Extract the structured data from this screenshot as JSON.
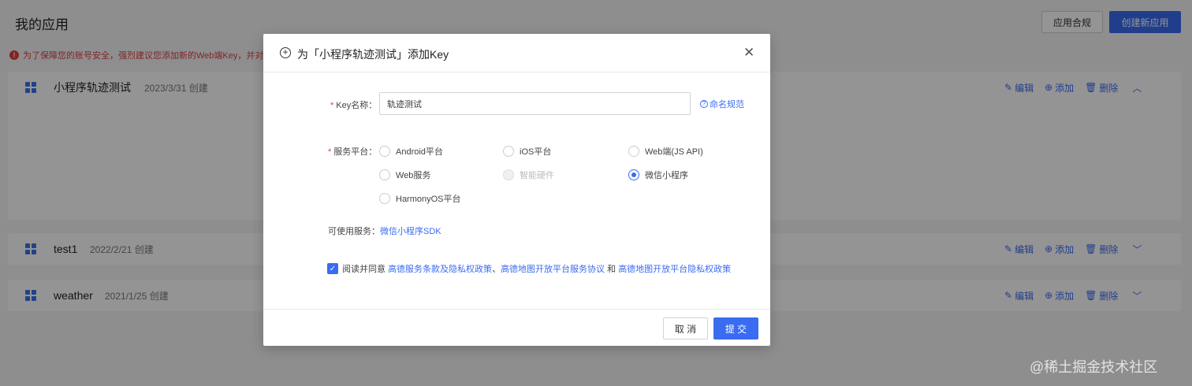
{
  "page": {
    "title": "我的应用",
    "compliance_button": "应用合规",
    "create_button": "创建新应用",
    "warning": "为了保障您的账号安全，强烈建议您添加新的Web端Key，并对原"
  },
  "apps": [
    {
      "name": "小程序轨迹测试",
      "date": "2023/3/31 创建",
      "edit": "编辑",
      "add": "添加",
      "delete": "删除"
    },
    {
      "name": "test1",
      "date": "2022/2/21 创建",
      "edit": "编辑",
      "add": "添加",
      "delete": "删除"
    },
    {
      "name": "weather",
      "date": "2021/1/25 创建",
      "edit": "编辑",
      "add": "添加",
      "delete": "删除"
    }
  ],
  "modal": {
    "title": "为「小程序轨迹测试」添加Key",
    "key_name_label": "Key名称：",
    "key_name_value": "轨迹测试",
    "naming_rule": "命名规范",
    "platform_label": "服务平台：",
    "platforms": [
      {
        "label": "Android平台",
        "checked": false,
        "disabled": false
      },
      {
        "label": "iOS平台",
        "checked": false,
        "disabled": false
      },
      {
        "label": "Web端(JS API)",
        "checked": false,
        "disabled": false
      },
      {
        "label": "Web服务",
        "checked": false,
        "disabled": false
      },
      {
        "label": "智能硬件",
        "checked": false,
        "disabled": true
      },
      {
        "label": "微信小程序",
        "checked": true,
        "disabled": false
      },
      {
        "label": "HarmonyOS平台",
        "checked": false,
        "disabled": false
      }
    ],
    "available_services_label": "可使用服务：",
    "available_services_value": "微信小程序SDK",
    "agree_prefix": "阅读并同意",
    "agree_link1": "高德服务条款及隐私权政策",
    "agree_sep": "、",
    "agree_link2": "高德地图开放平台服务协议",
    "agree_and": "和",
    "agree_link3": "高德地图开放平台隐私权政策",
    "cancel": "取 消",
    "submit": "提 交"
  },
  "watermark": "@稀土掘金技术社区",
  "colors": {
    "accent": "#3a6cf2",
    "danger": "#e0403c"
  }
}
